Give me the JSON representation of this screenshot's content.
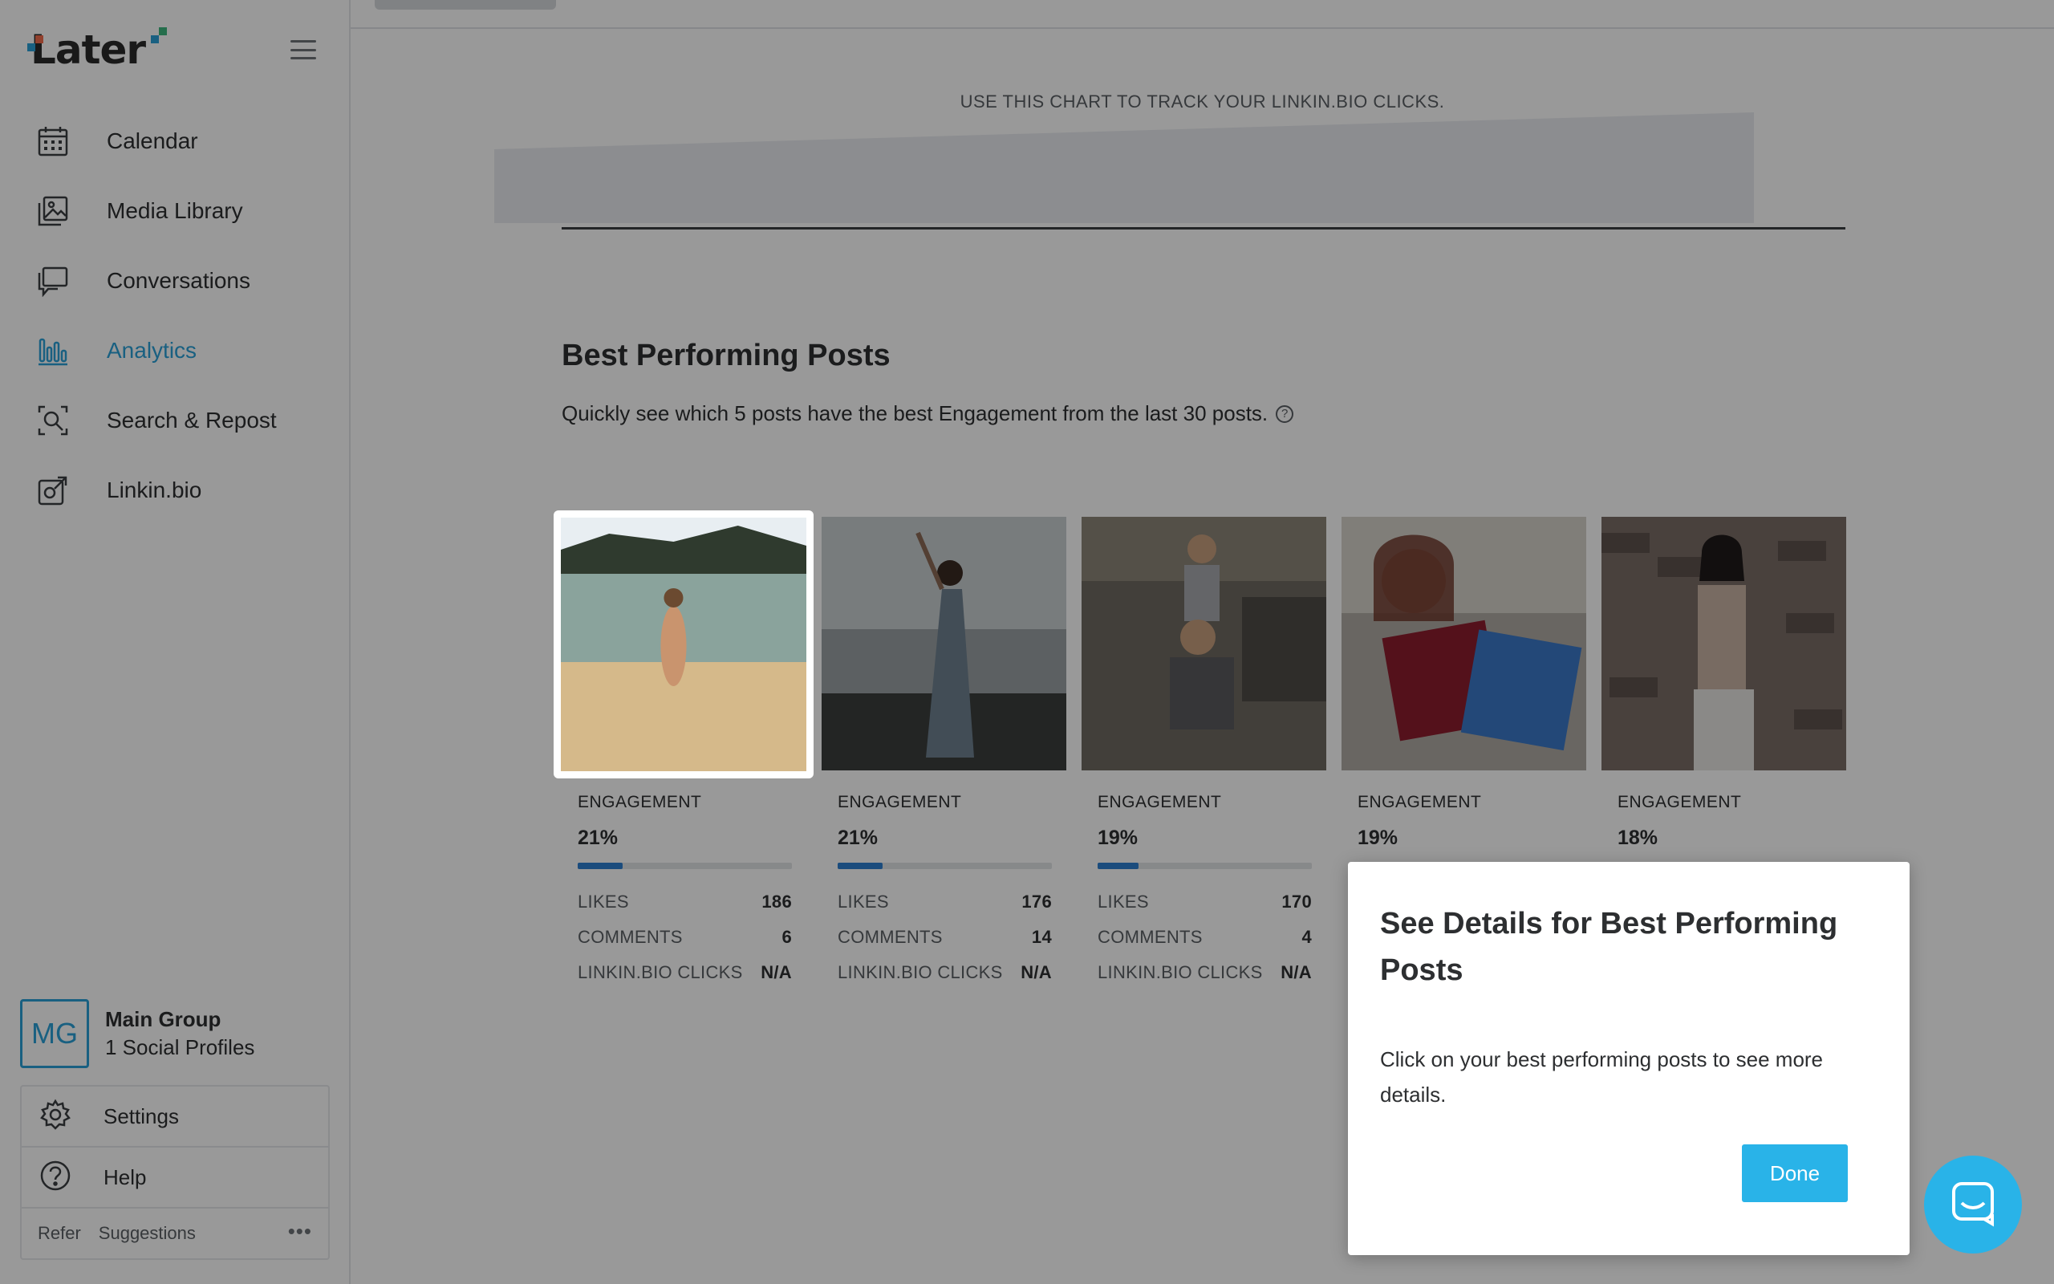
{
  "brand": {
    "logo_text": "Later",
    "accent": "#2aa0d8",
    "button_color": "#29b3e8"
  },
  "sidebar": {
    "items": [
      {
        "label": "Calendar",
        "icon": "calendar-icon"
      },
      {
        "label": "Media Library",
        "icon": "media-library-icon"
      },
      {
        "label": "Conversations",
        "icon": "conversations-icon"
      },
      {
        "label": "Analytics",
        "icon": "analytics-icon",
        "active": true
      },
      {
        "label": "Search & Repost",
        "icon": "search-repost-icon"
      },
      {
        "label": "Linkin.bio",
        "icon": "linkinbio-icon"
      }
    ],
    "account": {
      "initials": "MG",
      "name": "Main Group",
      "profiles": "1 Social Profiles"
    },
    "settings_label": "Settings",
    "help_label": "Help",
    "refer_label": "Refer",
    "suggestions_label": "Suggestions",
    "more_label": "•••"
  },
  "main": {
    "chart_caption": "USE THIS CHART TO TRACK YOUR LINKIN.BIO CLICKS.",
    "section_title": "Best Performing Posts",
    "section_subtitle": "Quickly see which 5 posts have the best Engagement from the last 30 posts.",
    "help_glyph": "?",
    "labels": {
      "engagement": "ENGAGEMENT",
      "likes": "LIKES",
      "comments": "COMMENTS",
      "clicks": "LINKIN.BIO CLICKS"
    },
    "posts": [
      {
        "engagement": "21%",
        "engagement_fraction": 0.21,
        "likes": "186",
        "comments": "6",
        "clicks": "N/A"
      },
      {
        "engagement": "21%",
        "engagement_fraction": 0.21,
        "likes": "176",
        "comments": "14",
        "clicks": "N/A"
      },
      {
        "engagement": "19%",
        "engagement_fraction": 0.19,
        "likes": "170",
        "comments": "4",
        "clicks": "N/A"
      },
      {
        "engagement": "19%",
        "engagement_fraction": 0.19
      },
      {
        "engagement": "18%",
        "engagement_fraction": 0.18
      }
    ]
  },
  "popup": {
    "title": "See Details for Best Performing Posts",
    "body": "Click on your best performing posts to see more details.",
    "done_label": "Done"
  }
}
